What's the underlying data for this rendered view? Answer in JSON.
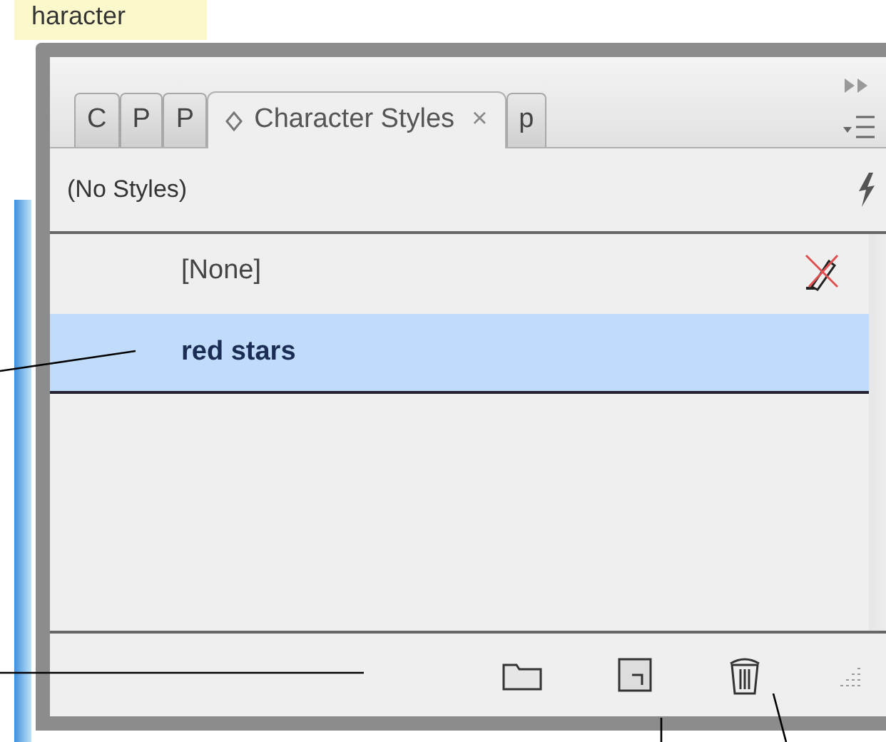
{
  "tooltip": {
    "text": "haracter"
  },
  "tabs": [
    {
      "label": "C",
      "selected": false
    },
    {
      "label": "P",
      "selected": false
    },
    {
      "label": "P",
      "selected": false
    },
    {
      "label": "Character Styles",
      "selected": true,
      "close": "×"
    },
    {
      "label": "p",
      "selected": false
    }
  ],
  "header": {
    "text": "(No Styles)"
  },
  "styles": [
    {
      "name": "[None]",
      "selected": false
    },
    {
      "name": "red stars",
      "selected": true
    }
  ]
}
